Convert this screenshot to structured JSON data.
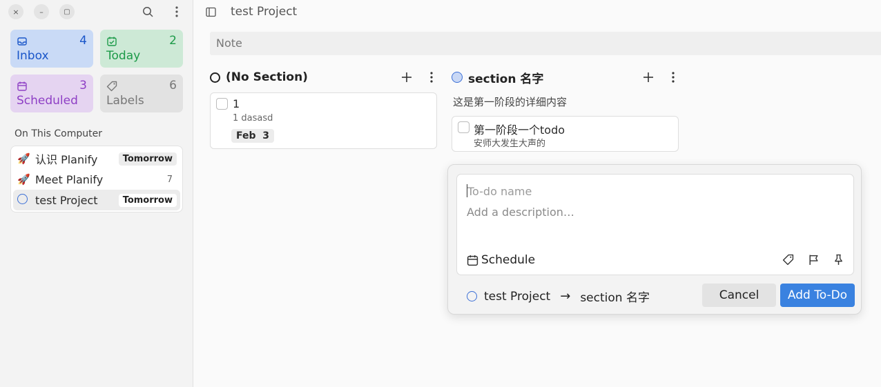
{
  "window": {
    "close_glyph": "×",
    "minimize_glyph": "–",
    "maximize_glyph": "▢"
  },
  "sidebar": {
    "tiles": {
      "inbox": {
        "label": "Inbox",
        "count": "4",
        "color": "#1a56c9",
        "bg": "#c9daf6"
      },
      "today": {
        "label": "Today",
        "count": "2",
        "color": "#1c9a48",
        "bg": "#cde9d6"
      },
      "scheduled": {
        "label": "Scheduled",
        "count": "3",
        "color": "#8e3fc5",
        "bg": "#e5d4f1"
      },
      "labels": {
        "label": "Labels",
        "count": "6",
        "color": "#777777",
        "bg": "#e2e2e2"
      }
    },
    "section_title": "On This Computer",
    "projects": [
      {
        "emoji": "🚀",
        "name": "认识 Planify",
        "badge": "Tomorrow"
      },
      {
        "emoji": "🚀",
        "name": "Meet Planify",
        "count": "7"
      },
      {
        "name": "test Project",
        "badge": "Tomorrow"
      }
    ]
  },
  "main": {
    "project_title": "test Project",
    "note_placeholder": "Note",
    "sections": [
      {
        "title": "(No Section)",
        "tasks": [
          {
            "title": "1",
            "description": "1 dasasd",
            "due": "Feb  3"
          }
        ]
      },
      {
        "title": "section 名字",
        "description": "这是第一阶段的详细内容",
        "tasks": [
          {
            "title": "第一阶段一个todo",
            "description": "安师大发生大声的"
          }
        ]
      }
    ]
  },
  "new_todo": {
    "name_placeholder": "To-do name",
    "description_placeholder": "Add a description…",
    "schedule_label": "Schedule",
    "project": "test Project",
    "arrow": "→",
    "section": "section 名字",
    "cancel_label": "Cancel",
    "add_label": "Add To-Do"
  },
  "colors": {
    "accent": "#3a82e0"
  }
}
